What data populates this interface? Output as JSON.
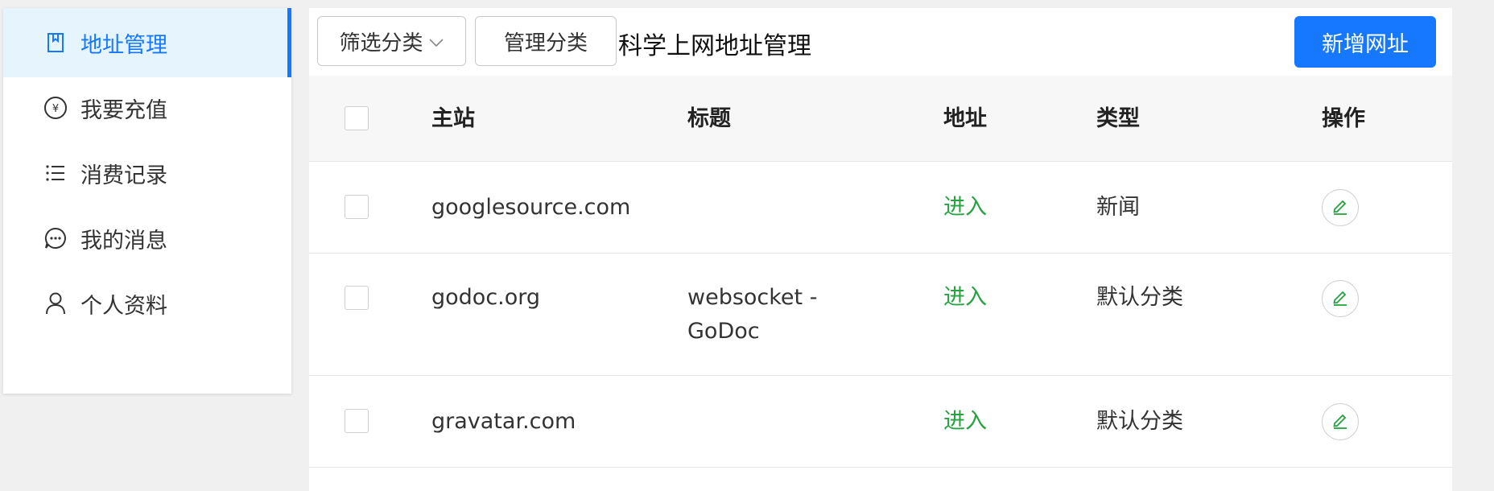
{
  "sidebar": {
    "items": [
      {
        "label": "地址管理",
        "icon": "bookmark-icon",
        "active": true
      },
      {
        "label": "我要充值",
        "icon": "yuan-coin-icon",
        "active": false
      },
      {
        "label": "消费记录",
        "icon": "list-icon",
        "active": false
      },
      {
        "label": "我的消息",
        "icon": "chat-bubble-icon",
        "active": false
      },
      {
        "label": "个人资料",
        "icon": "user-icon",
        "active": false
      }
    ]
  },
  "toolbar": {
    "filter_label": "筛选分类",
    "manage_label": "管理分类",
    "title": "科学上网地址管理",
    "add_label": "新增网址"
  },
  "table": {
    "headers": {
      "site": "主站",
      "title": "标题",
      "address": "地址",
      "type": "类型",
      "action": "操作"
    },
    "rows": [
      {
        "site": "googlesource.com",
        "title": "",
        "address": "进入",
        "type": "新闻"
      },
      {
        "site": "godoc.org",
        "title_line1": "websocket -",
        "title_line2": "GoDoc",
        "address": "进入",
        "type": "默认分类"
      },
      {
        "site": "gravatar.com",
        "title": "",
        "address": "进入",
        "type": "默认分类"
      }
    ]
  },
  "colors": {
    "accent": "#1677ff",
    "link": "#26a340",
    "active_bg": "#e6f4fd"
  }
}
